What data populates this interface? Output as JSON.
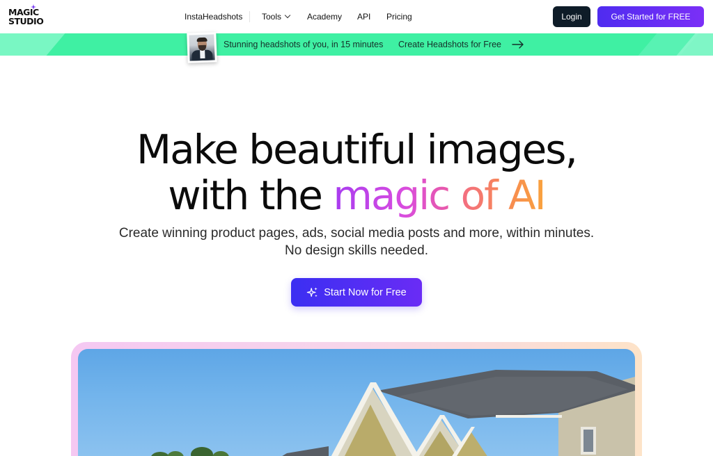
{
  "header": {
    "logo": {
      "line1": "MAGIC",
      "line2": "STUDIO"
    },
    "nav": {
      "instaheadshots": "InstaHeadshots",
      "tools": "Tools",
      "academy": "Academy",
      "api": "API",
      "pricing": "Pricing"
    },
    "login_label": "Login",
    "get_started_label": "Get Started for FREE"
  },
  "banner": {
    "text": "Stunning headshots of you, in 15 minutes",
    "cta": "Create Headshots for Free"
  },
  "hero": {
    "title_line1": "Make beautiful images,",
    "title_line2_prefix": "with the ",
    "title_magic": "magic",
    "title_of_ai": " of AI",
    "subtitle_line1": "Create winning product pages, ads, social media posts and more, within minutes.",
    "subtitle_line2": "No design skills needed.",
    "start_button_label": "Start Now for Free"
  },
  "colors": {
    "accent": "#4f2cf0",
    "banner": "#3ff0a3",
    "login_bg": "#0e1c28"
  },
  "icons": {
    "logo_star": "sparkle-star-icon",
    "nav_tools": "chevron-down-icon",
    "banner_cta": "arrow-right-icon",
    "start_button": "sparkles-icon"
  }
}
